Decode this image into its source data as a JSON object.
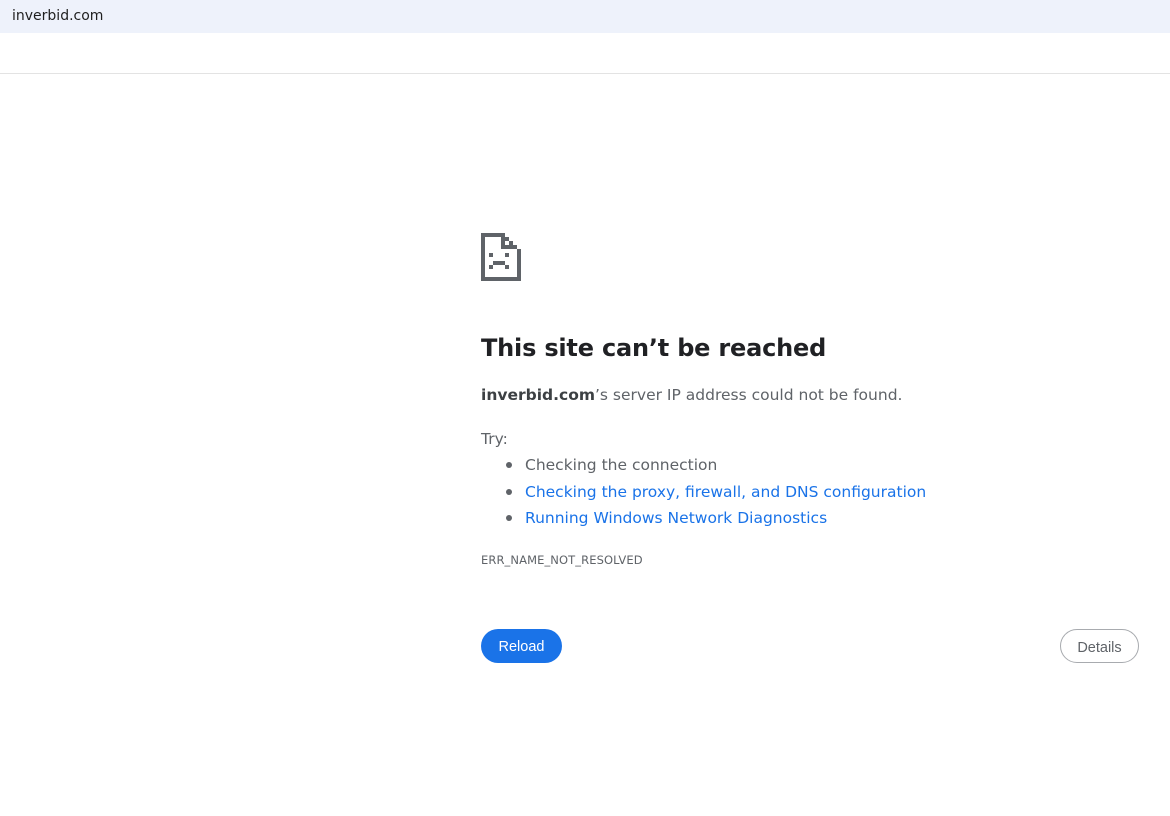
{
  "address_bar": {
    "url": "inverbid.com"
  },
  "error_page": {
    "icon": "sad-document-icon",
    "title": "This site can’t be reached",
    "summary_host": "inverbid.com",
    "summary_rest": "’s server IP address could not be found.",
    "try_label": "Try:",
    "suggestions": [
      {
        "text": "Checking the connection",
        "link": false
      },
      {
        "text": "Checking the proxy, firewall, and DNS configuration",
        "link": true
      },
      {
        "text": "Running Windows Network Diagnostics",
        "link": true
      }
    ],
    "error_code": "ERR_NAME_NOT_RESOLVED",
    "reload_label": "Reload",
    "details_label": "Details"
  },
  "colors": {
    "accent": "#1a73e8",
    "text": "#5f6368",
    "heading": "#202124",
    "address_bar_bg": "#eef2fb"
  }
}
